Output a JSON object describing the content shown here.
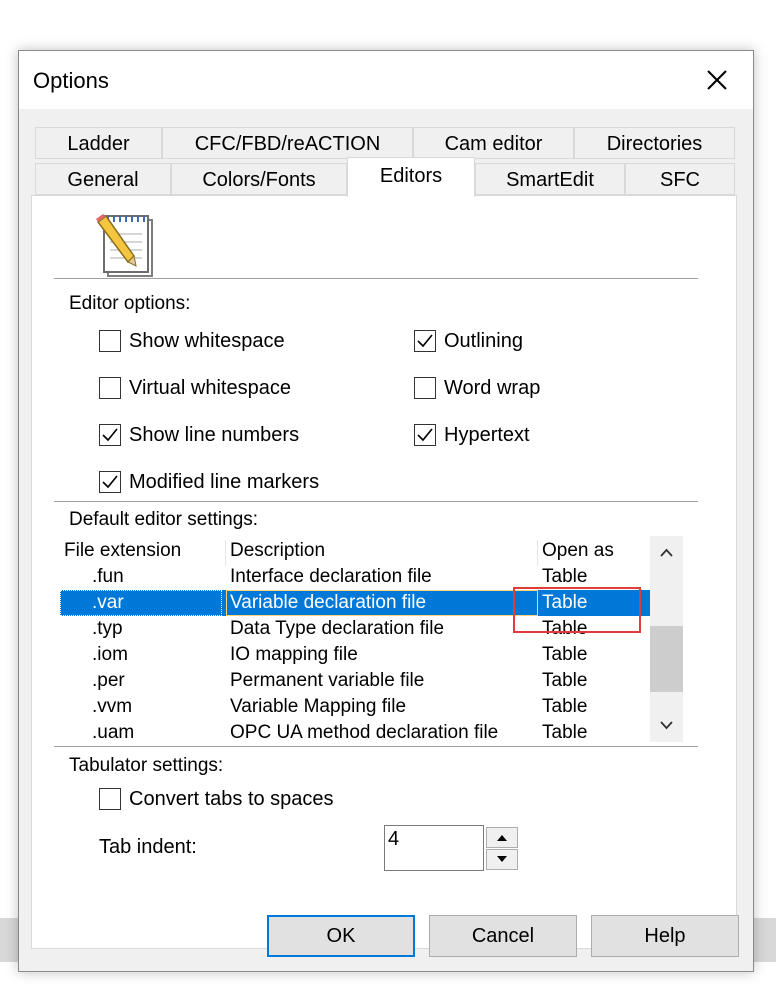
{
  "dialog": {
    "title": "Options"
  },
  "tabs": {
    "row_top": [
      "Ladder",
      "CFC/FBD/reACTION",
      "Cam editor",
      "Directories"
    ],
    "row_bottom": [
      "General",
      "Colors/Fonts",
      "Editors",
      "SmartEdit",
      "SFC"
    ],
    "active": "Editors"
  },
  "editor_options": {
    "label": "Editor options:",
    "show_whitespace": {
      "label": "Show whitespace",
      "checked": false
    },
    "virtual_whitespace": {
      "label": "Virtual whitespace",
      "checked": false
    },
    "show_line_numbers": {
      "label": "Show line numbers",
      "checked": true
    },
    "modified_line_markers": {
      "label": "Modified line markers",
      "checked": true
    },
    "outlining": {
      "label": "Outlining",
      "checked": true
    },
    "word_wrap": {
      "label": "Word wrap",
      "checked": false
    },
    "hypertext": {
      "label": "Hypertext",
      "checked": true
    }
  },
  "default_editor": {
    "label": "Default editor settings:",
    "columns": [
      "File extension",
      "Description",
      "Open as"
    ],
    "rows": [
      {
        "ext": ".fun",
        "desc": "Interface declaration file",
        "open": "Table"
      },
      {
        "ext": ".var",
        "desc": "Variable declaration file",
        "open": "Table",
        "selected": true
      },
      {
        "ext": ".typ",
        "desc": "Data Type declaration file",
        "open": "Table"
      },
      {
        "ext": ".iom",
        "desc": "IO mapping file",
        "open": "Table"
      },
      {
        "ext": ".per",
        "desc": "Permanent variable file",
        "open": "Table"
      },
      {
        "ext": ".vvm",
        "desc": "Variable Mapping file",
        "open": "Table"
      },
      {
        "ext": ".uam",
        "desc": "OPC UA method declaration file",
        "open": "Table"
      }
    ]
  },
  "tabulator": {
    "label": "Tabulator settings:",
    "convert_tabs": {
      "label": "Convert tabs to spaces",
      "checked": false
    },
    "tab_indent_label": "Tab indent:",
    "tab_indent_value": "4"
  },
  "buttons": {
    "ok": "OK",
    "cancel": "Cancel",
    "help": "Help"
  },
  "colors": {
    "accent": "#0078d7",
    "highlight_box": "#e03c3c",
    "selection_text": "#ffffff"
  }
}
